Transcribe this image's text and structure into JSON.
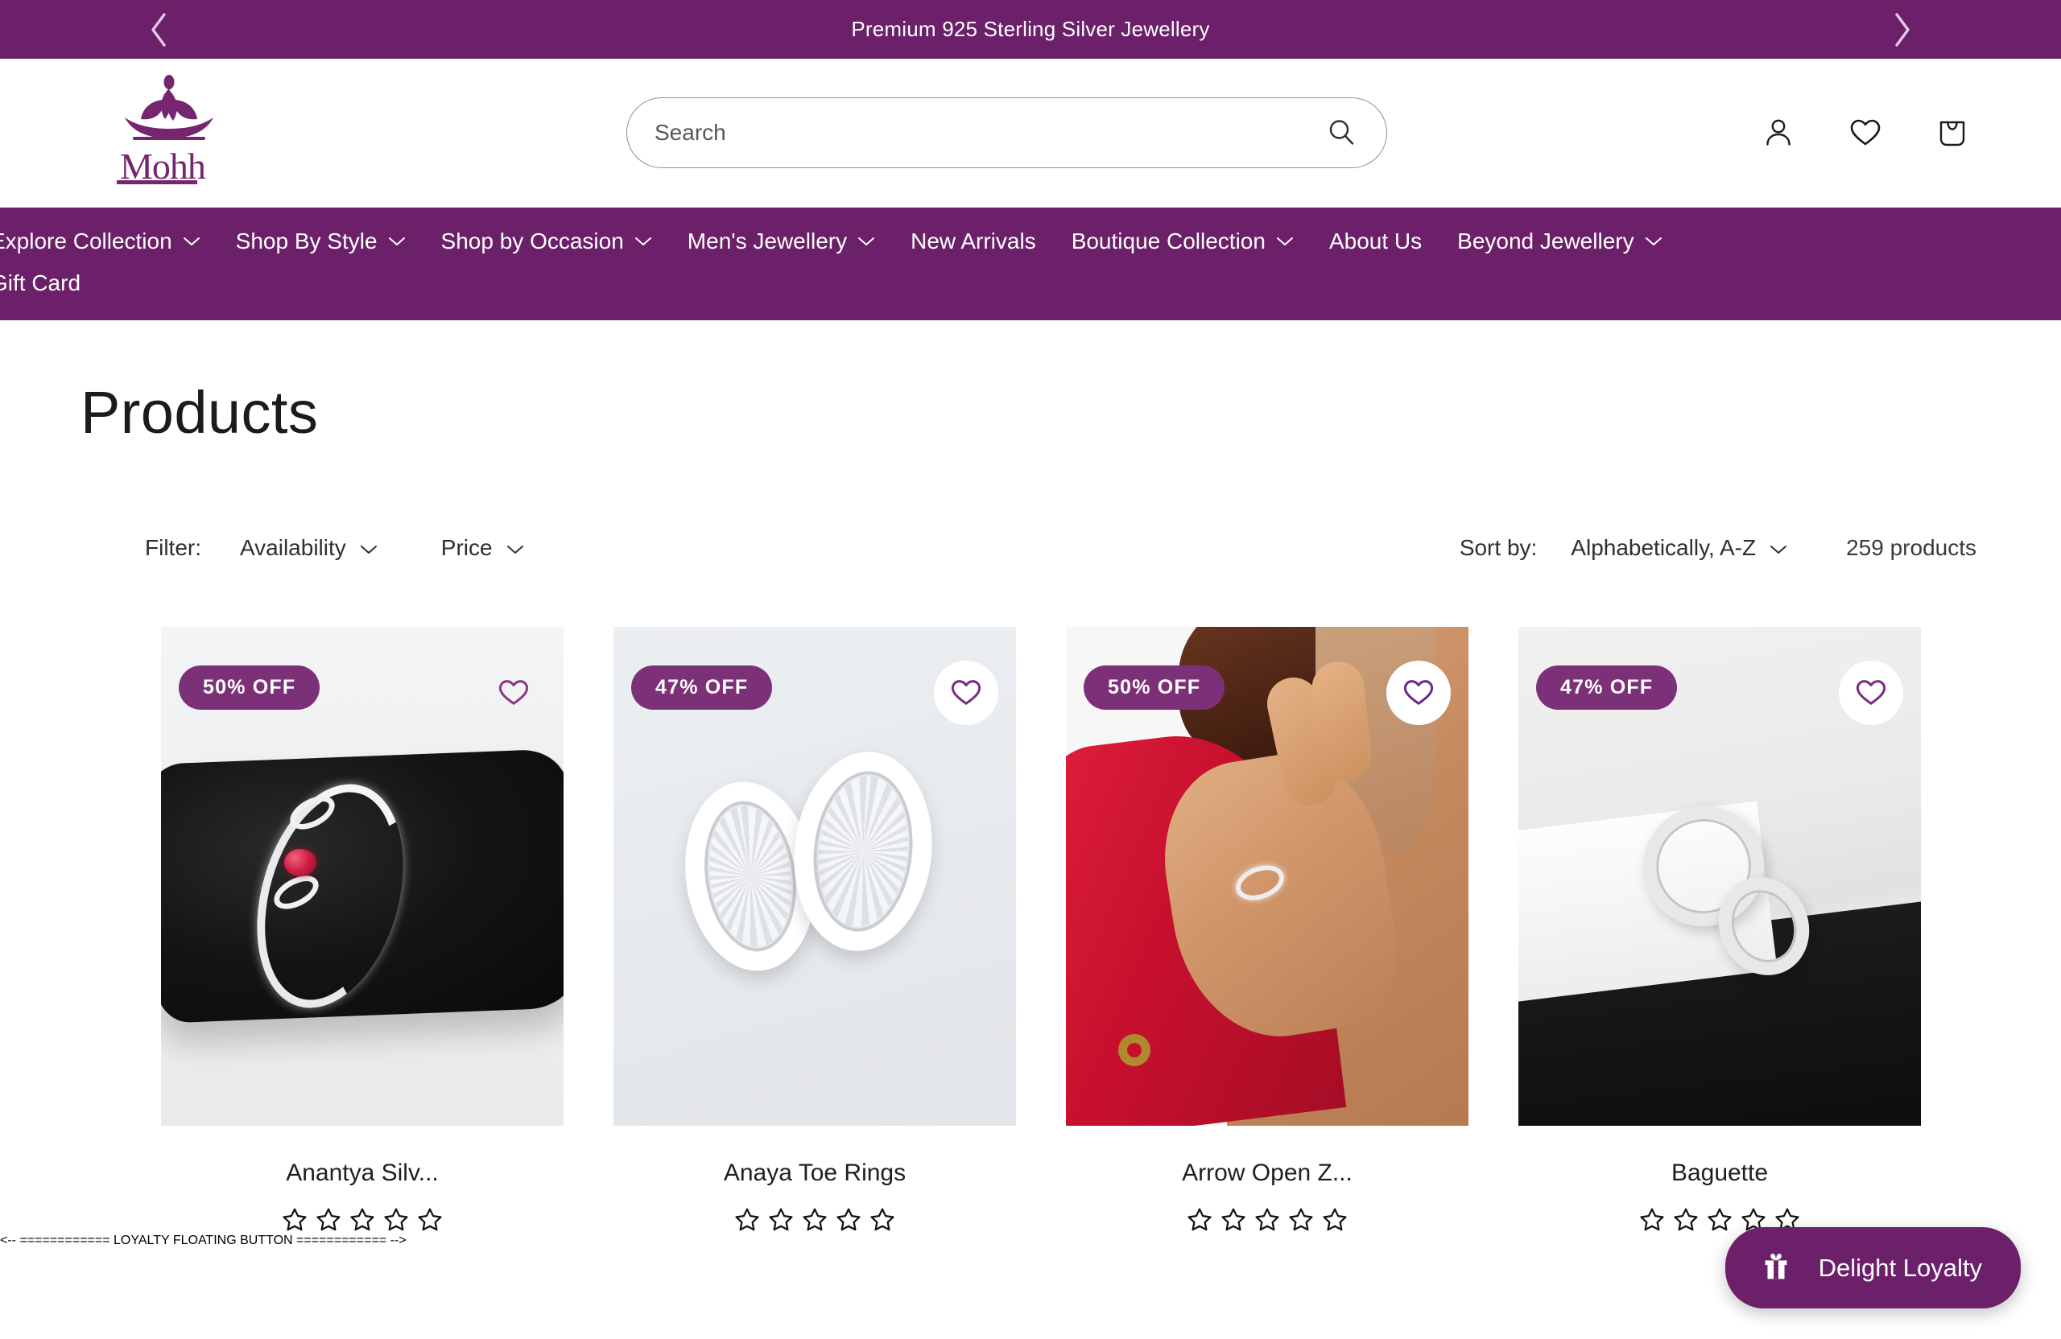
{
  "announcement": {
    "text": "Premium 925 Sterling Silver Jewellery",
    "prev_icon": "chevron-left-icon",
    "next_icon": "chevron-right-icon",
    "background": "#6B2069"
  },
  "header": {
    "logo_text": "Mohh",
    "logo_icon": "lotus-icon",
    "search": {
      "placeholder": "Search",
      "value": "",
      "submit_icon": "search-icon"
    },
    "icons": [
      {
        "name": "account-icon",
        "label": "Account"
      },
      {
        "name": "wishlist-heart-icon",
        "label": "Wishlist"
      },
      {
        "name": "cart-bag-icon",
        "label": "Cart"
      }
    ]
  },
  "nav": {
    "items": [
      {
        "label": "Explore Collection",
        "has_caret": true
      },
      {
        "label": "Shop By Style",
        "has_caret": true
      },
      {
        "label": "Shop by Occasion",
        "has_caret": true
      },
      {
        "label": "Men's Jewellery",
        "has_caret": true
      },
      {
        "label": "New Arrivals",
        "has_caret": false
      },
      {
        "label": "Boutique Collection",
        "has_caret": true
      },
      {
        "label": "About Us",
        "has_caret": false
      },
      {
        "label": "Beyond Jewellery",
        "has_caret": true
      },
      {
        "label": "Gift Card",
        "has_caret": false
      }
    ]
  },
  "main": {
    "title": "Products",
    "filter_label": "Filter:",
    "filters": [
      {
        "label": "Availability"
      },
      {
        "label": "Price"
      }
    ],
    "sort_label": "Sort by:",
    "sort_value": "Alphabetically, A-Z",
    "product_count": "259 products"
  },
  "products": [
    {
      "title": "Anantya Silv...",
      "badge": "50% OFF",
      "rating": 0,
      "stars_total": 5,
      "wishlist_icon": "heart-icon",
      "wishlist_has_circle": false,
      "image_alt": "silver infinity bangle with ruby on black velvet cushion"
    },
    {
      "title": "Anaya Toe Rings",
      "badge": "47% OFF",
      "rating": 0,
      "stars_total": 5,
      "wishlist_icon": "heart-icon",
      "wishlist_has_circle": true,
      "image_alt": "pair of patterned silver toe rings on grey background"
    },
    {
      "title": "Arrow Open Z...",
      "badge": "50% OFF",
      "rating": 0,
      "stars_total": 5,
      "wishlist_icon": "heart-icon",
      "wishlist_has_circle": true,
      "image_alt": "model in red top wearing open arrow ring, hand on chest"
    },
    {
      "title": "Baguette",
      "badge": "47% OFF",
      "rating": 0,
      "stars_total": 5,
      "wishlist_icon": "heart-icon",
      "wishlist_has_circle": true,
      "image_alt": "baguette cubic zirconia wrap ring on black and white display"
    }
  ],
  "loyalty": {
    "label": "Delight Loyalty",
    "icon": "gift-icon",
    "background": "#6B2069"
  },
  "colors": {
    "brand_purple": "#6B2069",
    "badge_purple": "#7C3078",
    "text_dark": "#1c1b1b",
    "white": "#ffffff"
  }
}
